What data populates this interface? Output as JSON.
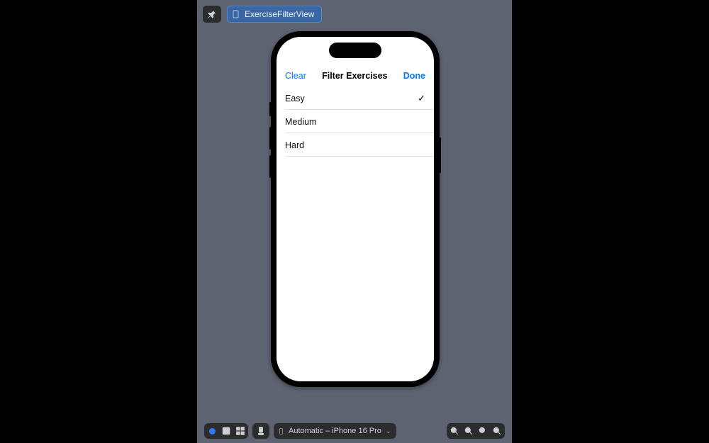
{
  "top_bar": {
    "file_chip_label": "ExerciseFilterView"
  },
  "phone": {
    "nav": {
      "left_button": "Clear",
      "title": "Filter Exercises",
      "right_button": "Done"
    },
    "rows": [
      {
        "label": "Easy",
        "checked": true
      },
      {
        "label": "Medium",
        "checked": false
      },
      {
        "label": "Hard",
        "checked": false
      }
    ]
  },
  "bottom_bar": {
    "device_label": "Automatic – iPhone 16 Pro"
  }
}
